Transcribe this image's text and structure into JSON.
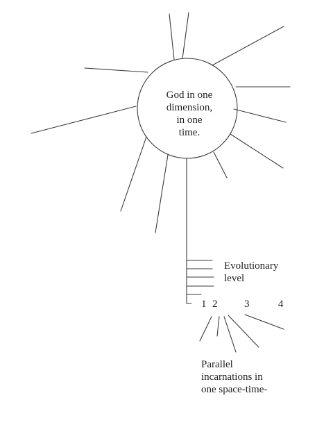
{
  "center": {
    "lines": [
      "God in one",
      "dimension,",
      "in one",
      "time."
    ]
  },
  "evolutionary": {
    "lines": [
      "Evolutionary",
      "level"
    ]
  },
  "level_numbers": [
    "1",
    "2",
    "3",
    "4"
  ],
  "parallel": {
    "lines": [
      "Parallel",
      "incarnations in",
      "one space-time-"
    ]
  },
  "colors": {
    "stroke": "#3a3a3a",
    "text": "#1e1e1e",
    "background": "#ffffff"
  }
}
